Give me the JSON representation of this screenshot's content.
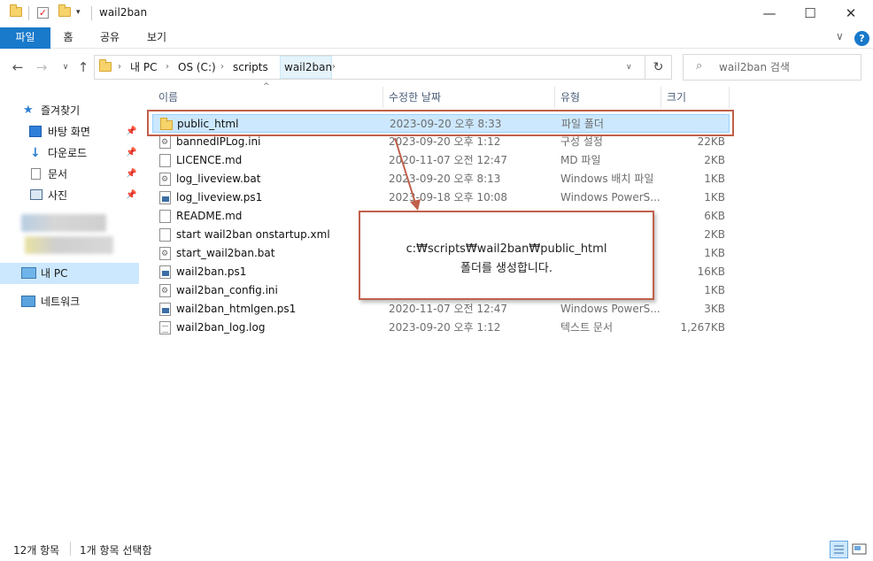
{
  "window": {
    "title": "wail2ban",
    "controls": {
      "minimize": "—",
      "maximize": "☐",
      "close": "✕"
    }
  },
  "ribbon": {
    "tabs": [
      "파일",
      "홈",
      "공유",
      "보기"
    ],
    "help": "?"
  },
  "address": {
    "crumbs": [
      "내 PC",
      "OS (C:)",
      "scripts",
      "wail2ban"
    ],
    "search_placeholder": "wail2ban 검색"
  },
  "nav": {
    "quick_access": "즐겨찾기",
    "items": [
      "바탕 화면",
      "다운로드",
      "문서",
      "사진"
    ],
    "this_pc": "내 PC",
    "network": "네트워크"
  },
  "columns": {
    "name": "이름",
    "date": "수정한 날짜",
    "type": "유형",
    "size": "크기"
  },
  "files": [
    {
      "name": "public_html",
      "date": "2023-09-20 오후 8:33",
      "type": "파일 폴더",
      "size": "",
      "icon": "folder-icon",
      "selected": true
    },
    {
      "name": "bannedIPLog.ini",
      "date": "2023-09-20 오후 1:12",
      "type": "구성 설정",
      "size": "22KB",
      "icon": "settings-file-icon"
    },
    {
      "name": "LICENCE.md",
      "date": "2020-11-07 오전 12:47",
      "type": "MD 파일",
      "size": "2KB",
      "icon": "document-icon"
    },
    {
      "name": "log_liveview.bat",
      "date": "2023-09-20 오후 8:13",
      "type": "Windows 배치 파일",
      "size": "1KB",
      "icon": "batch-file-icon"
    },
    {
      "name": "log_liveview.ps1",
      "date": "2023-09-18 오후 10:08",
      "type": "Windows PowerS...",
      "size": "1KB",
      "icon": "powershell-file-icon"
    },
    {
      "name": "README.md",
      "date": "",
      "type": "",
      "size": "6KB",
      "icon": "document-icon"
    },
    {
      "name": "start wail2ban onstartup.xml",
      "date": "",
      "type": "",
      "size": "2KB",
      "icon": "document-icon"
    },
    {
      "name": "start_wail2ban.bat",
      "date": "",
      "type": "",
      "size": "1KB",
      "icon": "batch-file-icon"
    },
    {
      "name": "wail2ban.ps1",
      "date": "",
      "type": "",
      "size": "16KB",
      "icon": "powershell-file-icon"
    },
    {
      "name": "wail2ban_config.ini",
      "date": "",
      "type": "",
      "size": "1KB",
      "icon": "settings-file-icon"
    },
    {
      "name": "wail2ban_htmlgen.ps1",
      "date": "2020-11-07 오전 12:47",
      "type": "Windows PowerS...",
      "size": "3KB",
      "icon": "powershell-file-icon"
    },
    {
      "name": "wail2ban_log.log",
      "date": "2023-09-20 오후 1:12",
      "type": "텍스트 문서",
      "size": "1,267KB",
      "icon": "text-file-icon"
    }
  ],
  "callout": {
    "line1": "c:₩scripts₩wail2ban₩public_html",
    "line2": "폴더를 생성합니다."
  },
  "status": {
    "count": "12개 항목",
    "selection": "1개 항목 선택함"
  },
  "colors": {
    "accent": "#1979ca",
    "annotation": "#c0604b",
    "selection": "#cce8ff"
  }
}
